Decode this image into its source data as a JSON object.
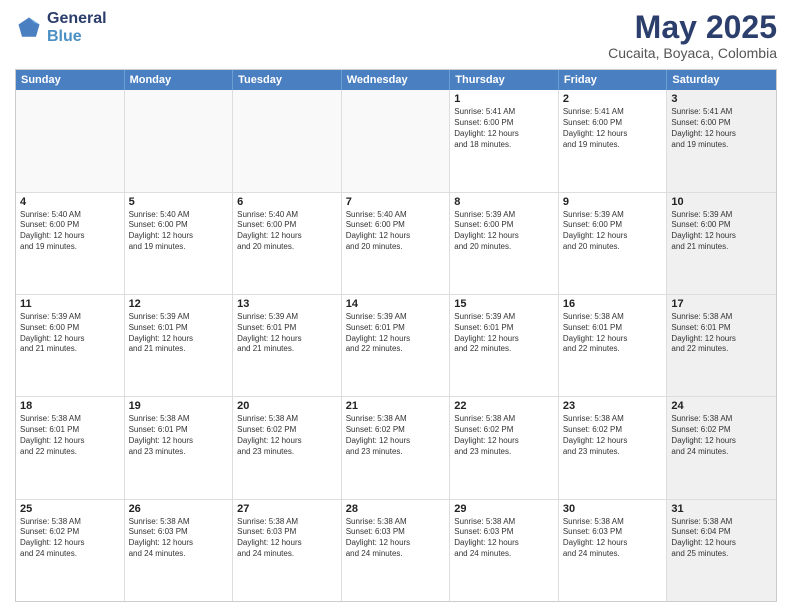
{
  "logo": {
    "general": "General",
    "blue": "Blue"
  },
  "header": {
    "title": "May 2025",
    "subtitle": "Cucaita, Boyaca, Colombia"
  },
  "weekdays": [
    "Sunday",
    "Monday",
    "Tuesday",
    "Wednesday",
    "Thursday",
    "Friday",
    "Saturday"
  ],
  "rows": [
    [
      {
        "day": "",
        "info": "",
        "empty": true
      },
      {
        "day": "",
        "info": "",
        "empty": true
      },
      {
        "day": "",
        "info": "",
        "empty": true
      },
      {
        "day": "",
        "info": "",
        "empty": true
      },
      {
        "day": "1",
        "info": "Sunrise: 5:41 AM\nSunset: 6:00 PM\nDaylight: 12 hours\nand 18 minutes."
      },
      {
        "day": "2",
        "info": "Sunrise: 5:41 AM\nSunset: 6:00 PM\nDaylight: 12 hours\nand 19 minutes."
      },
      {
        "day": "3",
        "info": "Sunrise: 5:41 AM\nSunset: 6:00 PM\nDaylight: 12 hours\nand 19 minutes.",
        "shaded": true
      }
    ],
    [
      {
        "day": "4",
        "info": "Sunrise: 5:40 AM\nSunset: 6:00 PM\nDaylight: 12 hours\nand 19 minutes."
      },
      {
        "day": "5",
        "info": "Sunrise: 5:40 AM\nSunset: 6:00 PM\nDaylight: 12 hours\nand 19 minutes."
      },
      {
        "day": "6",
        "info": "Sunrise: 5:40 AM\nSunset: 6:00 PM\nDaylight: 12 hours\nand 20 minutes."
      },
      {
        "day": "7",
        "info": "Sunrise: 5:40 AM\nSunset: 6:00 PM\nDaylight: 12 hours\nand 20 minutes."
      },
      {
        "day": "8",
        "info": "Sunrise: 5:39 AM\nSunset: 6:00 PM\nDaylight: 12 hours\nand 20 minutes."
      },
      {
        "day": "9",
        "info": "Sunrise: 5:39 AM\nSunset: 6:00 PM\nDaylight: 12 hours\nand 20 minutes."
      },
      {
        "day": "10",
        "info": "Sunrise: 5:39 AM\nSunset: 6:00 PM\nDaylight: 12 hours\nand 21 minutes.",
        "shaded": true
      }
    ],
    [
      {
        "day": "11",
        "info": "Sunrise: 5:39 AM\nSunset: 6:00 PM\nDaylight: 12 hours\nand 21 minutes."
      },
      {
        "day": "12",
        "info": "Sunrise: 5:39 AM\nSunset: 6:01 PM\nDaylight: 12 hours\nand 21 minutes."
      },
      {
        "day": "13",
        "info": "Sunrise: 5:39 AM\nSunset: 6:01 PM\nDaylight: 12 hours\nand 21 minutes."
      },
      {
        "day": "14",
        "info": "Sunrise: 5:39 AM\nSunset: 6:01 PM\nDaylight: 12 hours\nand 22 minutes."
      },
      {
        "day": "15",
        "info": "Sunrise: 5:39 AM\nSunset: 6:01 PM\nDaylight: 12 hours\nand 22 minutes."
      },
      {
        "day": "16",
        "info": "Sunrise: 5:38 AM\nSunset: 6:01 PM\nDaylight: 12 hours\nand 22 minutes."
      },
      {
        "day": "17",
        "info": "Sunrise: 5:38 AM\nSunset: 6:01 PM\nDaylight: 12 hours\nand 22 minutes.",
        "shaded": true
      }
    ],
    [
      {
        "day": "18",
        "info": "Sunrise: 5:38 AM\nSunset: 6:01 PM\nDaylight: 12 hours\nand 22 minutes."
      },
      {
        "day": "19",
        "info": "Sunrise: 5:38 AM\nSunset: 6:01 PM\nDaylight: 12 hours\nand 23 minutes."
      },
      {
        "day": "20",
        "info": "Sunrise: 5:38 AM\nSunset: 6:02 PM\nDaylight: 12 hours\nand 23 minutes."
      },
      {
        "day": "21",
        "info": "Sunrise: 5:38 AM\nSunset: 6:02 PM\nDaylight: 12 hours\nand 23 minutes."
      },
      {
        "day": "22",
        "info": "Sunrise: 5:38 AM\nSunset: 6:02 PM\nDaylight: 12 hours\nand 23 minutes."
      },
      {
        "day": "23",
        "info": "Sunrise: 5:38 AM\nSunset: 6:02 PM\nDaylight: 12 hours\nand 23 minutes."
      },
      {
        "day": "24",
        "info": "Sunrise: 5:38 AM\nSunset: 6:02 PM\nDaylight: 12 hours\nand 24 minutes.",
        "shaded": true
      }
    ],
    [
      {
        "day": "25",
        "info": "Sunrise: 5:38 AM\nSunset: 6:02 PM\nDaylight: 12 hours\nand 24 minutes."
      },
      {
        "day": "26",
        "info": "Sunrise: 5:38 AM\nSunset: 6:03 PM\nDaylight: 12 hours\nand 24 minutes."
      },
      {
        "day": "27",
        "info": "Sunrise: 5:38 AM\nSunset: 6:03 PM\nDaylight: 12 hours\nand 24 minutes."
      },
      {
        "day": "28",
        "info": "Sunrise: 5:38 AM\nSunset: 6:03 PM\nDaylight: 12 hours\nand 24 minutes."
      },
      {
        "day": "29",
        "info": "Sunrise: 5:38 AM\nSunset: 6:03 PM\nDaylight: 12 hours\nand 24 minutes."
      },
      {
        "day": "30",
        "info": "Sunrise: 5:38 AM\nSunset: 6:03 PM\nDaylight: 12 hours\nand 24 minutes."
      },
      {
        "day": "31",
        "info": "Sunrise: 5:38 AM\nSunset: 6:04 PM\nDaylight: 12 hours\nand 25 minutes.",
        "shaded": true
      }
    ]
  ]
}
